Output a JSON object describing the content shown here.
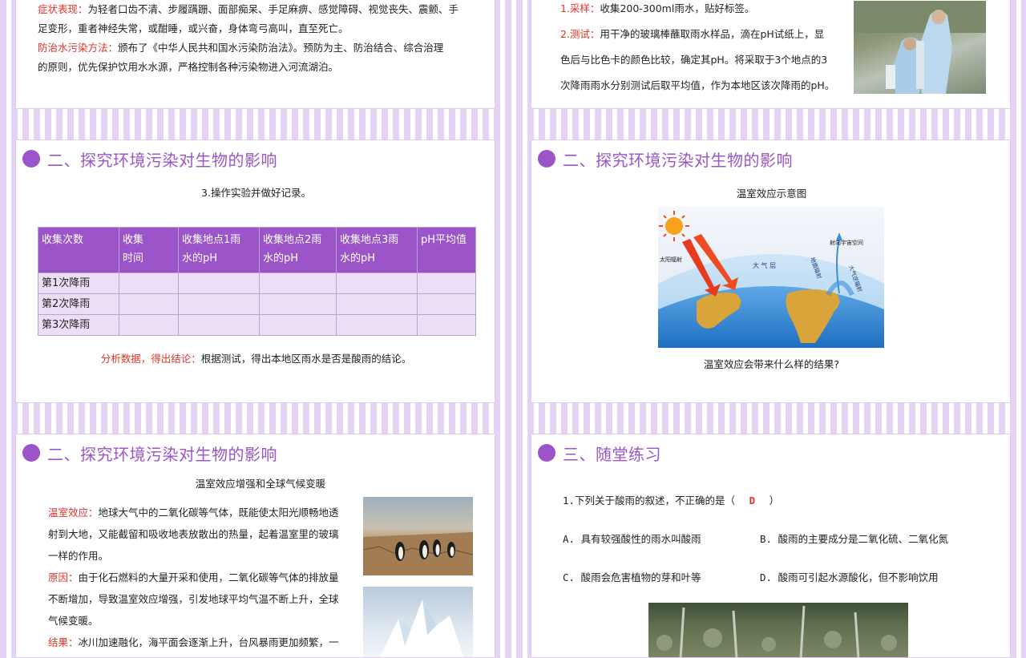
{
  "slide1": {
    "symptom_label": "症状表现：",
    "symptom_text1": "为轻者口齿不清、步履蹒跚、面部痴呆、手足麻痹、感觉障碍、视觉丧失、震颤、手",
    "symptom_text2": "足变形，重者神经失常，或酣睡，或兴奋，身体弯弓高叫，直至死亡。",
    "method_label": "防治水污染方法：",
    "method_text1": "颁布了《中华人民共和国水污染防治法》。预防为主、防治结合、综合治理",
    "method_text2": "的原则，优先保护饮用水水源，严格控制各种污染物进入河流湖泊。"
  },
  "slide2": {
    "step1_label": "1.采样：",
    "step1_text": "收集200-300ml雨水，贴好标签。",
    "step2_label": "2.测试：",
    "step2_text1": "用干净的玻璃棒蘸取雨水样品，滴在pH试纸上，显",
    "step2_text2": "色后与比色卡的颜色比较，确定其pH。将采取于3个地点的3",
    "step2_text3": "次降雨雨水分别测试后取平均值，作为本地区该次降雨的pH。"
  },
  "slide3": {
    "title": "二、探究环境污染对生物的影响",
    "step3": "3.操作实验并做好记录。",
    "table": {
      "headers": [
        [
          "收集次数",
          ""
        ],
        [
          "收集",
          "时间"
        ],
        [
          "收集地点1雨",
          "水的pH"
        ],
        [
          "收集地点2雨",
          "水的pH"
        ],
        [
          "收集地点3雨",
          "水的pH"
        ],
        [
          "pH平均值",
          ""
        ]
      ],
      "rows": [
        "第1次降雨",
        "第2次降雨",
        "第3次降雨"
      ]
    },
    "analysis_label": "分析数据，得出结论：",
    "analysis_text": "根据测试，得出本地区雨水是否是酸雨的结论。"
  },
  "slide4": {
    "title": "二、探究环境污染对生物的影响",
    "caption": "温室效应示意图",
    "diagram": {
      "solar": "太阳辐射",
      "space": "射向宇宙空间",
      "atmosphere": "大 气 层",
      "ground": "地面辐射",
      "counter": "大气逆辐射"
    },
    "question": "温室效应会带来什么样的结果?"
  },
  "slide5": {
    "title": "二、探究环境污染对生物的影响",
    "subtitle": "温室效应增强和全球气候变暖",
    "effect_label": "温室效应：",
    "effect_text1": "地球大气中的二氧化碳等气体，既能使太阳光顺畅地透",
    "effect_text2": "射到大地，又能截留和吸收地表放散出的热量，起着温室里的玻璃",
    "effect_text3": "一样的作用。",
    "cause_label": "原因：",
    "cause_text1": "由于化石燃料的大量开采和使用，二氧化碳等气体的排放量",
    "cause_text2": "不断增加，导致温室效应增强，引发地球平均气温不断上升，全球",
    "cause_text3": "气候变暖。",
    "result_label": "结果：",
    "result_text1": "冰川加速融化，海平面会逐渐上升，台风暴雨更加频繁，一"
  },
  "slide6": {
    "title": "三、随堂练习",
    "question_prefix": "1.下列关于酸雨的叙述，不正确的是（",
    "answer": "D",
    "question_suffix": "）",
    "optA": "A. 具有较强酸性的雨水叫酸雨",
    "optB": "B. 酸雨的主要成分是二氧化硫、二氧化氮",
    "optC": "C. 酸雨会危害植物的芽和叶等",
    "optD": "D. 酸雨可引起水源酸化，但不影响饮用"
  },
  "colors": {
    "accent": "#9b55c9",
    "red": "#e23227",
    "table_cell": "#ebdef6"
  }
}
